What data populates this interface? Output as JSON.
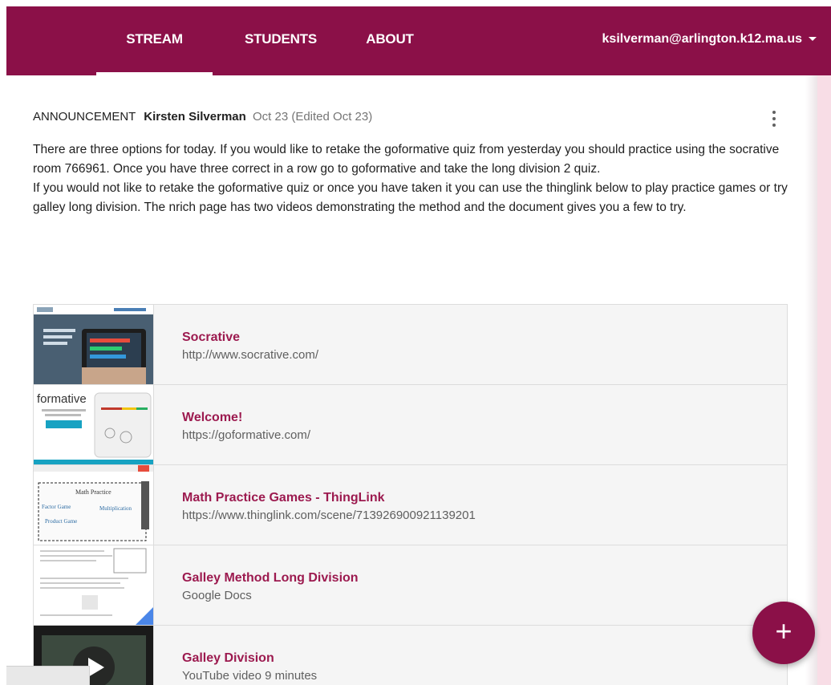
{
  "nav": {
    "tabs": [
      {
        "label": "STREAM",
        "active": true
      },
      {
        "label": "STUDENTS"
      },
      {
        "label": "ABOUT"
      }
    ],
    "account": "ksilverman@arlington.k12.ma.us",
    "bar_color": "#8b1048"
  },
  "post": {
    "type": "ANNOUNCEMENT",
    "author": "Kirsten Silverman",
    "date": "Oct 23 (Edited Oct 23)",
    "body": [
      "There are three options for today. If you would like to retake the goformative quiz from yesterday you should practice using the socrative room 766961. Once you have three correct in a row go to goformative and take the long division 2 quiz.",
      "If you would not like to retake the goformative quiz or once you have taken it you can use the thinglink below to play practice games or try galley long division. The nrich page has two videos demonstrating the method and the document gives you a few to try."
    ],
    "attachments": [
      {
        "title": "Socrative",
        "subtitle": "http://www.socrative.com/",
        "thumb": "socrative-screenshot"
      },
      {
        "title": "Welcome!",
        "subtitle": "https://goformative.com/",
        "thumb": "formative-screenshot"
      },
      {
        "title": "Math Practice Games - ThingLink",
        "subtitle": "https://www.thinglink.com/scene/713926900921139201",
        "thumb": "thinglink-screenshot"
      },
      {
        "title": "Galley Method Long Division",
        "subtitle": "Google Docs",
        "thumb": "google-doc-preview"
      },
      {
        "title": "Galley Division",
        "subtitle": "YouTube video  9 minutes",
        "thumb": "video-thumbnail"
      }
    ]
  },
  "fab_icon": "+",
  "accent": "#9c1a4f"
}
